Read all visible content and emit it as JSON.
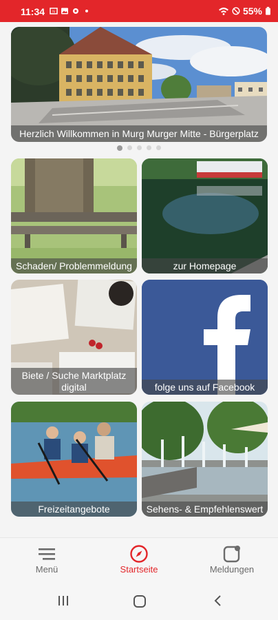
{
  "status_bar": {
    "time": "11:34",
    "battery": "55%",
    "icons": [
      "sim-icon",
      "gallery-icon",
      "settings-icon",
      "dot-icon",
      "wifi-icon",
      "do-not-disturb-icon",
      "battery-icon"
    ]
  },
  "hero": {
    "caption": "Herzlich Willkommen in Murg Murger Mitte - Bürgerplatz",
    "pages": 5,
    "active_page": 1
  },
  "tiles": [
    {
      "id": "schaden",
      "label": "Schaden/ Problemmeldung"
    },
    {
      "id": "homepage",
      "label": "zur Homepage"
    },
    {
      "id": "marktplatz",
      "label": "Biete / Suche Marktplatz digital"
    },
    {
      "id": "facebook",
      "label": "folge uns auf Facebook"
    },
    {
      "id": "freizeit",
      "label": "Freizeitangebote"
    },
    {
      "id": "sehens",
      "label": "Sehens- & Empfehlenswert"
    }
  ],
  "bottom_nav": {
    "items": [
      {
        "label": "Menü",
        "icon": "menu-icon",
        "active": false
      },
      {
        "label": "Startseite",
        "icon": "compass-icon",
        "active": true
      },
      {
        "label": "Meldungen",
        "icon": "notification-icon",
        "active": false
      }
    ]
  },
  "colors": {
    "accent": "#e3262a",
    "facebook": "#3b5998",
    "caption_bg": "rgba(70,70,70,0.62)"
  }
}
